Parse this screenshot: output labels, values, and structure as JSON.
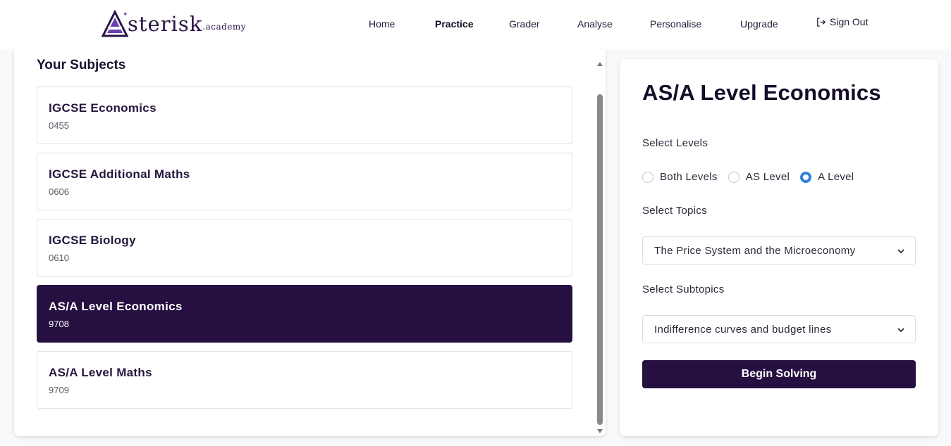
{
  "brand": {
    "logo_letter": "A",
    "logo_text": "sterisk",
    "logo_suffix": ".academy"
  },
  "nav": {
    "items": [
      {
        "label": "Home"
      },
      {
        "label": "Practice",
        "active": true
      },
      {
        "label": "Grader"
      },
      {
        "label": "Analyse"
      },
      {
        "label": "Personalise"
      },
      {
        "label": "Upgrade"
      }
    ],
    "sign_out": "Sign Out",
    "sign_out_icon": "sign-out-icon"
  },
  "subjects": {
    "title": "Your Subjects",
    "items": [
      {
        "name": "IGCSE Economics",
        "code": "0455"
      },
      {
        "name": "IGCSE Additional Maths",
        "code": "0606"
      },
      {
        "name": "IGCSE Biology",
        "code": "0610"
      },
      {
        "name": "AS/A Level Economics",
        "code": "9708",
        "selected": true
      },
      {
        "name": "AS/A Level Maths",
        "code": "9709"
      }
    ]
  },
  "detail": {
    "title": "AS/A Level Economics",
    "levels_label": "Select Levels",
    "levels": [
      {
        "label": "Both Levels",
        "checked": false
      },
      {
        "label": "AS Level",
        "checked": false
      },
      {
        "label": "A Level",
        "checked": true
      }
    ],
    "topics_label": "Select Topics",
    "topic_value": "The Price System and the Microeconomy",
    "subtopics_label": "Select Subtopics",
    "subtopic_value": "Indifference curves and budget lines",
    "begin_label": "Begin Solving"
  },
  "colors": {
    "brand_dark": "#261041",
    "radio_accent": "#2f7fe0"
  }
}
